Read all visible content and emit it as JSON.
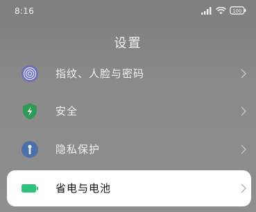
{
  "status_bar": {
    "time": "8:16",
    "battery": "100"
  },
  "header": {
    "title": "设置"
  },
  "settings_items": [
    {
      "label": "指纹、人脸与密码",
      "icon": "fingerprint-icon"
    },
    {
      "label": "安全",
      "icon": "shield-icon"
    },
    {
      "label": "隐私保护",
      "icon": "privacy-icon"
    },
    {
      "label": "省电与电池",
      "icon": "battery-icon"
    }
  ],
  "colors": {
    "fingerprint_icon": "#6a6fb8",
    "security_icon": "#2e9a55",
    "privacy_icon": "#4b6fa8",
    "battery_icon": "#2ec27e",
    "highlight_row": "#ffffff"
  }
}
